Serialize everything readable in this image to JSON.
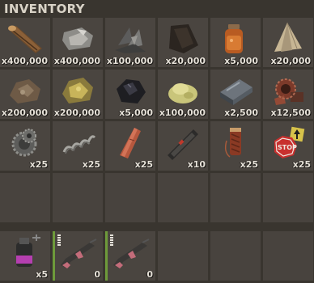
{
  "header": {
    "title": "INVENTORY"
  },
  "main_rows": [
    [
      {
        "icon": "wood-icon",
        "qty": "x400,000"
      },
      {
        "icon": "stones-icon",
        "qty": "x400,000"
      },
      {
        "icon": "metal-fragments-icon",
        "qty": "x100,000"
      },
      {
        "icon": "leather-icon",
        "qty": "x20,000"
      },
      {
        "icon": "low-grade-fuel-icon",
        "qty": "x5,000"
      },
      {
        "icon": "cloth-icon",
        "qty": "x20,000"
      }
    ],
    [
      {
        "icon": "metal-ore-icon",
        "qty": "x200,000"
      },
      {
        "icon": "sulfur-ore-icon",
        "qty": "x200,000"
      },
      {
        "icon": "charcoal-icon",
        "qty": "x5,000"
      },
      {
        "icon": "sulfur-icon",
        "qty": "x100,000"
      },
      {
        "icon": "high-quality-metal-icon",
        "qty": "x2,500"
      },
      {
        "icon": "scrap-icon",
        "qty": "x12,500"
      }
    ],
    [
      {
        "icon": "gears-icon",
        "qty": "x25"
      },
      {
        "icon": "metal-spring-icon",
        "qty": "x25"
      },
      {
        "icon": "tarp-icon",
        "qty": "x25"
      },
      {
        "icon": "semi-auto-body-icon",
        "qty": "x10"
      },
      {
        "icon": "rope-icon",
        "qty": "x25"
      },
      {
        "icon": "road-signs-icon",
        "qty": "x25"
      }
    ],
    [
      {
        "icon": "",
        "qty": ""
      },
      {
        "icon": "",
        "qty": ""
      },
      {
        "icon": "",
        "qty": ""
      },
      {
        "icon": "",
        "qty": ""
      },
      {
        "icon": "",
        "qty": ""
      },
      {
        "icon": "",
        "qty": ""
      }
    ]
  ],
  "belt": [
    {
      "icon": "smoke-grenade-icon",
      "qty": "x5"
    },
    {
      "icon": "assault-rifle-icon",
      "qty": "0"
    },
    {
      "icon": "assault-rifle-icon",
      "qty": "0"
    },
    {
      "icon": "",
      "qty": ""
    },
    {
      "icon": "",
      "qty": ""
    },
    {
      "icon": "",
      "qty": ""
    }
  ]
}
